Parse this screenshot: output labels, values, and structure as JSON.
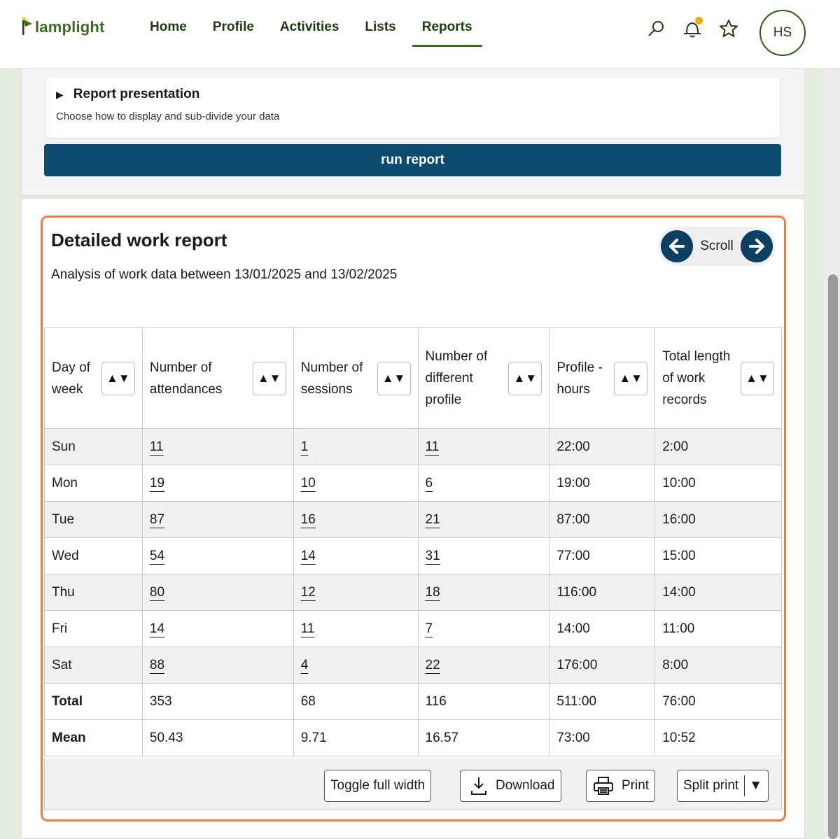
{
  "brand": {
    "name": "lamplight"
  },
  "nav": {
    "items": [
      {
        "label": "Home",
        "active": false
      },
      {
        "label": "Profile",
        "active": false
      },
      {
        "label": "Activities",
        "active": false
      },
      {
        "label": "Lists",
        "active": false
      },
      {
        "label": "Reports",
        "active": true
      }
    ],
    "icons": [
      "search-icon",
      "bell-icon",
      "star-icon"
    ],
    "avatar_initials": "HS"
  },
  "presentation": {
    "title": "Report presentation",
    "subtitle": "Choose how to display and sub-divide your data"
  },
  "run_button": "run report",
  "report": {
    "title": "Detailed work report",
    "subtitle": "Analysis of work data between 13/01/2025 and 13/02/2025",
    "scroll_label": "Scroll",
    "sort_symbol": "▲▼",
    "columns": [
      "Day of week",
      "Number of attendances",
      "Number of sessions",
      "Number of different profile",
      "Profile - hours",
      "Total length of work records"
    ],
    "rows": [
      [
        "Sun",
        "11",
        "1",
        "11",
        "22:00",
        "2:00"
      ],
      [
        "Mon",
        "19",
        "10",
        "6",
        "19:00",
        "10:00"
      ],
      [
        "Tue",
        "87",
        "16",
        "21",
        "87:00",
        "16:00"
      ],
      [
        "Wed",
        "54",
        "14",
        "31",
        "77:00",
        "15:00"
      ],
      [
        "Thu",
        "80",
        "12",
        "18",
        "116:00",
        "14:00"
      ],
      [
        "Fri",
        "14",
        "11",
        "7",
        "14:00",
        "11:00"
      ],
      [
        "Sat",
        "88",
        "4",
        "22",
        "176:00",
        "8:00"
      ]
    ],
    "totals": [
      [
        "Total",
        "353",
        "68",
        "116",
        "511:00",
        "76:00"
      ],
      [
        "Mean",
        "50.43",
        "9.71",
        "16.57",
        "73:00",
        "10:52"
      ]
    ]
  },
  "footer": {
    "toggle_label": "Toggle full width",
    "download_label": "Download",
    "print_label": "Print",
    "split_print_label": "Split print",
    "split_print_arrow": "▼"
  },
  "colors": {
    "brand_green": "#3b6b1f",
    "run_button_bg": "#0d4a70",
    "highlight_border": "#ef7a4b",
    "notification_dot": "#f2a900"
  }
}
